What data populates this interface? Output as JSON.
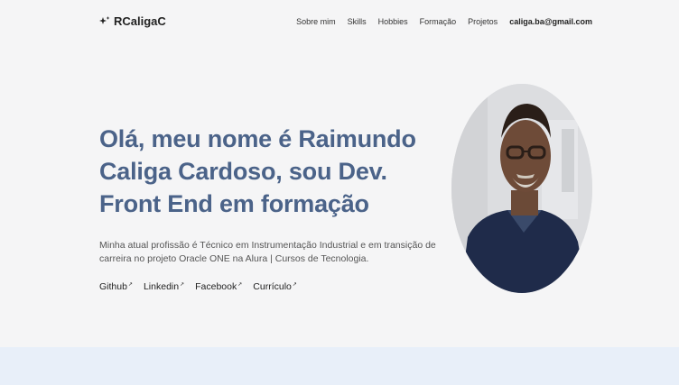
{
  "header": {
    "logo_text": "RCaligaC",
    "logo_icon": "sparkle-icon",
    "nav": [
      {
        "label": "Sobre mim"
      },
      {
        "label": "Skills"
      },
      {
        "label": "Hobbies"
      },
      {
        "label": "Formação"
      },
      {
        "label": "Projetos"
      }
    ],
    "email": "caliga.ba@gmail.com"
  },
  "hero": {
    "title": "Olá, meu nome é Raimundo Caliga Cardoso, sou Dev. Front End em formação",
    "description": "Minha atual profissão é Técnico em Instrumentação Industrial e em transição de carreira no projeto Oracle ONE na Alura | Cursos de Tecnologia.",
    "links": [
      {
        "label": "Github"
      },
      {
        "label": "Linkedin"
      },
      {
        "label": "Facebook"
      },
      {
        "label": "Currículo"
      }
    ],
    "link_icon": "↗"
  },
  "colors": {
    "background": "#f5f5f6",
    "title": "#4b6389",
    "bottom_band": "#e8eff9"
  }
}
